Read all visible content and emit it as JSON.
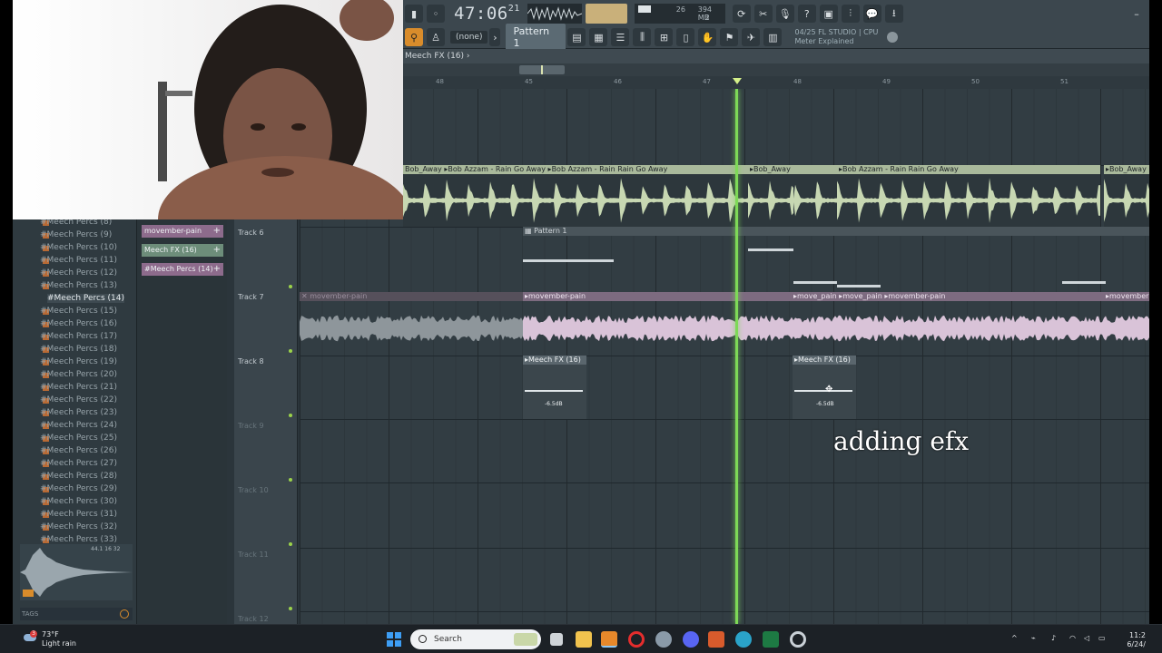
{
  "toolbar": {
    "time_main": "47:06",
    "time_sub": "21",
    "mem_top": "26",
    "mem_val": "394 MB",
    "mem_sub": "2",
    "pattern_label": "Pattern 1",
    "none_label": "(none)",
    "hint_line1": "04/25  FL STUDIO | CPU",
    "hint_line2": "Meter Explained"
  },
  "playlist": {
    "title": "Meech FX (16)",
    "ruler_marks": [
      "48",
      "45",
      "46",
      "47",
      "48",
      "49",
      "50",
      "51"
    ]
  },
  "browser": {
    "items": [
      "#Meech Percs (8)",
      "#Meech Percs (9)",
      "#Meech Percs (10)",
      "#Meech Percs (11)",
      "#Meech Percs (12)",
      "#Meech Percs (13)",
      "#Meech Percs (14)",
      "#Meech Percs (15)",
      "#Meech Percs (16)",
      "#Meech Percs (17)",
      "#Meech Percs (18)",
      "#Meech Percs (19)",
      "#Meech Percs (20)",
      "#Meech Percs (21)",
      "#Meech Percs (22)",
      "#Meech Percs (23)",
      "#Meech Percs (24)",
      "#Meech Percs (25)",
      "#Meech Percs (26)",
      "#Meech Percs (27)",
      "#Meech Percs (28)",
      "#Meech Percs (29)",
      "#Meech Percs (30)",
      "#Meech Percs (31)",
      "#Meech Percs (32)",
      "#Meech Percs (33)"
    ],
    "selected_index": 6,
    "preview_info": "44.1  16  32",
    "tags_label": "TAGS"
  },
  "picker": {
    "items": [
      {
        "label": "movember-pain",
        "color": "#8d6b8c"
      },
      {
        "label": "Meech FX (16)",
        "color": "#6d8d7a"
      },
      {
        "label": "#Meech Percs (14)",
        "color": "#8d6b8c"
      }
    ]
  },
  "tracks": [
    {
      "label": "Track 6",
      "dim": false
    },
    {
      "label": "Track 7",
      "dim": false
    },
    {
      "label": "Track 8",
      "dim": false
    },
    {
      "label": "Track 9",
      "dim": true
    },
    {
      "label": "Track 10",
      "dim": true
    },
    {
      "label": "Track 11",
      "dim": true
    },
    {
      "label": "Track 12",
      "dim": true
    }
  ],
  "clips": {
    "audio_top": [
      "Bob_Away",
      "Bob Azzam - Rain Go Away",
      "Bob Azzam - Rain Rain Go Away",
      "Bob_Away",
      "Bob Azzam - Rain Rain Go Away",
      "Bob_Away"
    ],
    "pattern": "Pattern 1",
    "track7": [
      "movember-pain",
      "movember-pain",
      "move_pain",
      "move_pain",
      "movember-pain",
      "movember"
    ],
    "fx": [
      "Meech FX (16)",
      "Meech FX (16)"
    ],
    "fx_volume": "-6.5dB"
  },
  "caption": "adding efx",
  "taskbar": {
    "temp": "73°F",
    "weather": "Light rain",
    "weather_badge": "3",
    "search": "Search",
    "clock_time": "11:2",
    "clock_date": "6/24/"
  },
  "colors": {
    "audio_green": "#c7d7b2",
    "audio_pink": "#d9c3d8",
    "playhead": "#7ed957",
    "clip_header_green": "#a9b99b",
    "clip_header_purple": "#7d6b80"
  }
}
